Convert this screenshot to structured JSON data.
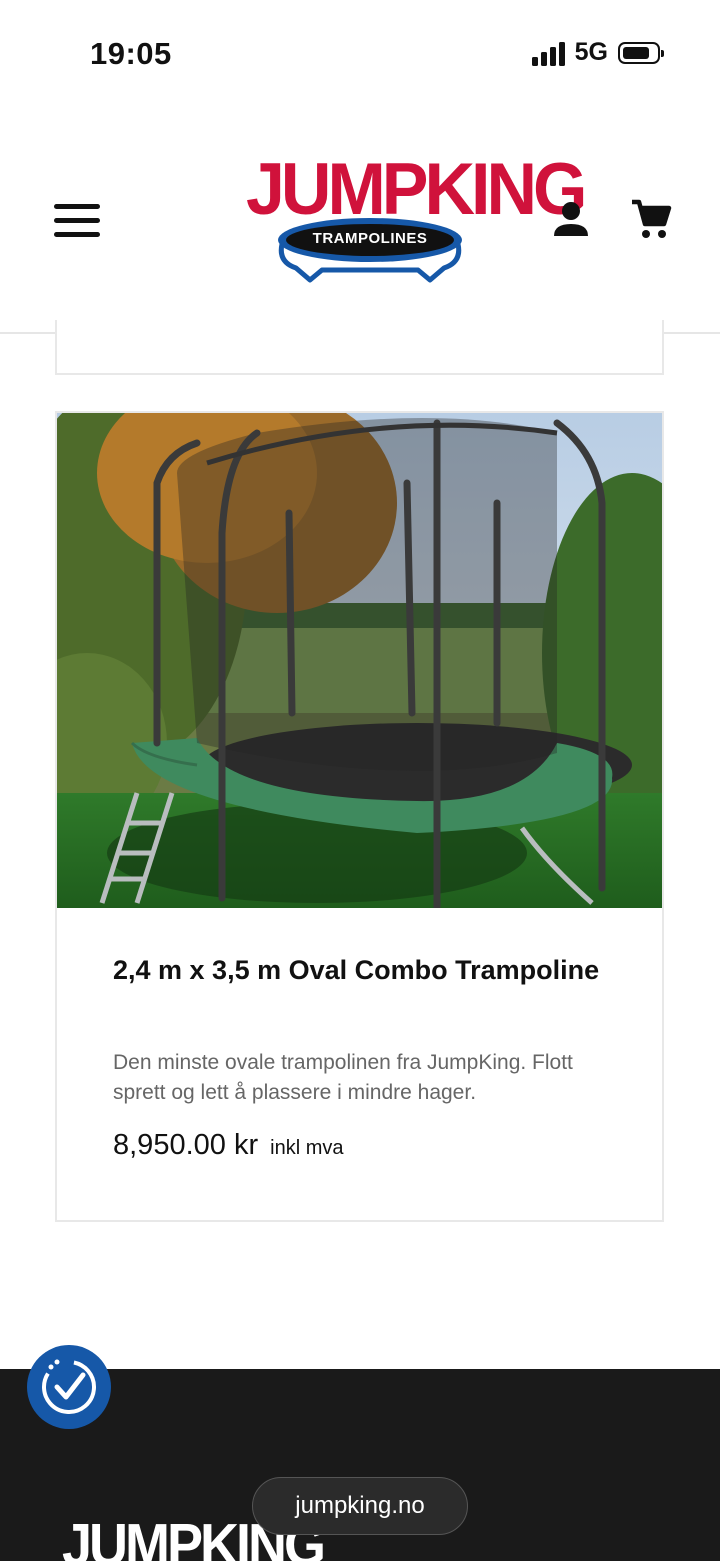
{
  "status_bar": {
    "time": "19:05",
    "network": "5G",
    "icons": [
      "signal-icon",
      "battery-icon"
    ]
  },
  "header": {
    "logo_text": "JUMPKING",
    "logo_subtext": "TRAMPOLINES",
    "icons": [
      "menu-icon",
      "account-icon",
      "cart-icon"
    ],
    "brand_red": "#d0123b",
    "brand_blue": "#1658a8"
  },
  "product": {
    "title": "2,4 m x 3,5 m Oval Combo Trampoline",
    "description": "Den minste ovale trampolinen fra JumpKing. Flott sprett og lett å plassere i mindre hager.",
    "price": "8,950.00 kr",
    "price_note": "inkl mva"
  },
  "footer": {
    "logo_text": "JUMPKING",
    "background": "#1a1a1a"
  },
  "accessibility": {
    "icon": "accessibility-icon"
  },
  "browser": {
    "url": "jumpking.no"
  }
}
